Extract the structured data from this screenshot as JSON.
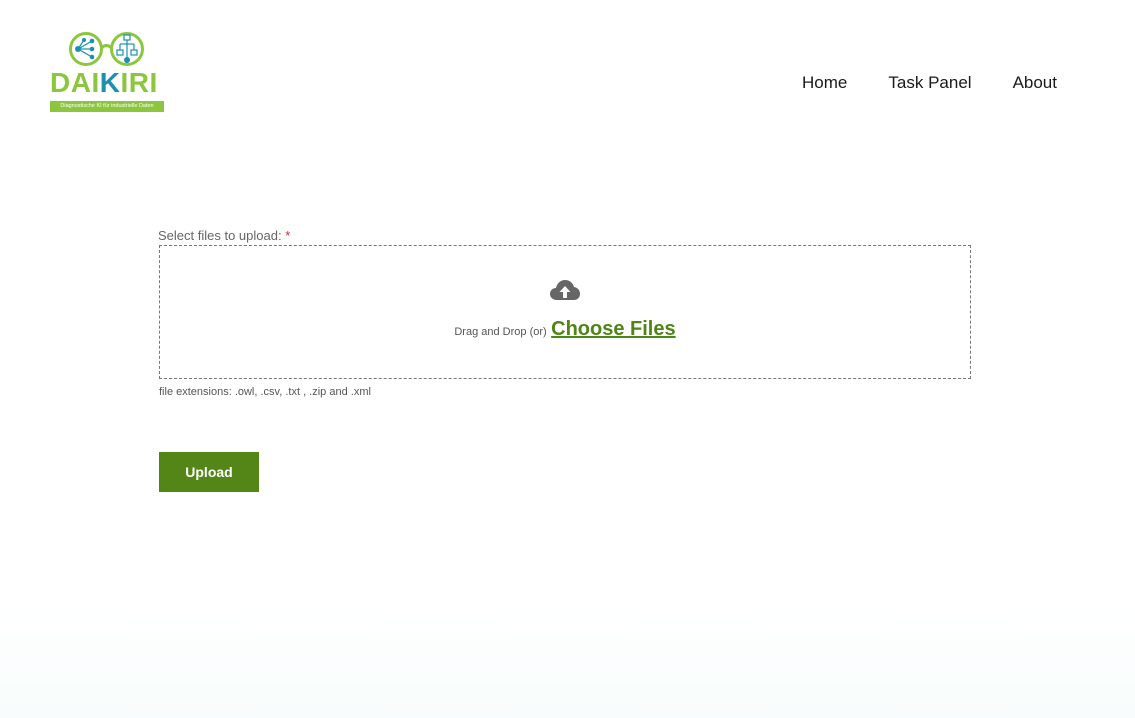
{
  "header": {
    "logo": {
      "title_part_a": "DAI",
      "title_part_b": "K",
      "title_part_c": "IRI",
      "tagline": "Diagnostische KI für industrielle Daten",
      "icon": "glasses-network-logo-icon",
      "colors": {
        "green": "#8cc63f",
        "blue": "#1c8fb3"
      }
    },
    "nav": {
      "items": [
        {
          "label": "Home"
        },
        {
          "label": "Task Panel"
        },
        {
          "label": "About"
        }
      ]
    }
  },
  "form": {
    "label": "Select files to upload:",
    "required_mark": "*",
    "dropzone": {
      "icon": "cloud-upload-icon",
      "drag_text": "Drag and Drop (or)",
      "choose_label": "Choose Files"
    },
    "hint": "file extensions: .owl, .csv, .txt , .zip and .xml",
    "upload_label": "Upload"
  },
  "colors": {
    "accent": "#538616",
    "link": "#4e8516",
    "required": "#e5202e"
  }
}
